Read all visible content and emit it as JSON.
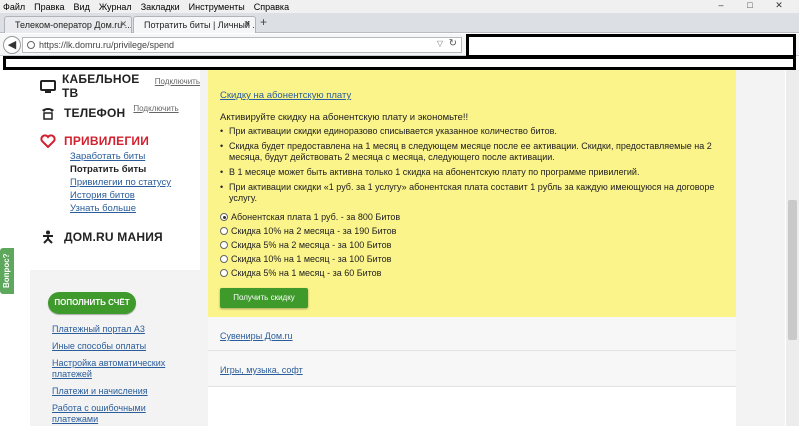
{
  "menu": [
    "Файл",
    "Правка",
    "Вид",
    "Журнал",
    "Закладки",
    "Инструменты",
    "Справка"
  ],
  "window_controls": [
    "–",
    "□",
    "✕"
  ],
  "tabs": [
    {
      "title": "Телеком-оператор Дом.ru ...",
      "close": "✕"
    },
    {
      "title": "Потратить биты | Личный ...",
      "close": "✕"
    }
  ],
  "new_tab": "+",
  "url": "https://lk.domru.ru/privilege/spend",
  "sidebar": {
    "sections": [
      {
        "title": "Кабельное ТВ",
        "off": "Подключить",
        "icon": "tv-icon"
      },
      {
        "title": "Телефон",
        "off": "Подключить",
        "icon": "phone-icon"
      },
      {
        "title": "Привилегии",
        "icon": "heart-icon"
      },
      {
        "title": "Дом.ru мания",
        "icon": "figure-icon"
      }
    ],
    "privilege_items": [
      "Заработать биты",
      "Потратить биты",
      "Привилегии по статусу",
      "История битов",
      "Узнать больше"
    ],
    "topup": "ПОПОЛНИТЬ СЧЁТ",
    "links": [
      "Платежный портал А3",
      "Иные способы оплаты",
      "Настройка автоматических платежей",
      "Платежи и начисления",
      "Работа с ошибочными платежами"
    ]
  },
  "vopros": "Вопрос?",
  "main": {
    "heading": "Скидку на абонентскую плату",
    "intro": "Активируйте скидку на абонентскую плату и экономьте!!",
    "bullets": [
      "При активации скидки единоразово списывается указанное количество битов.",
      "Скидка будет предоставлена на 1 месяц в следующем месяце после ее активации. Скидки, предоставляемые на 2 месяца, будут действовать 2 месяца с месяца, следующего после активации.",
      "В 1 месяце может быть активна только 1 скидка на абонентскую плату по программе привилегий.",
      "При активации скидки «1 руб. за 1 услугу» абонентская плата составит 1 рубль за каждую имеющуюся на договоре услугу."
    ],
    "options": [
      "Абонентская плата 1 руб. - за 800 Битов",
      "Скидка 10% на 2 месяца - за 190 Битов",
      "Скидка 5% на 2 месяца - за 100 Битов",
      "Скидка 10% на 1 месяц - за 100 Битов",
      "Скидка 5% на 1 месяц - за 60 Битов"
    ],
    "get_button": "Получить скидку",
    "sections": [
      "Сувениры Дом.ru",
      "Игры, музыка, софт"
    ]
  },
  "colors": {
    "accent_green": "#3d9a2b",
    "highlight_yellow": "#fbf48b",
    "brand_red": "#d3202e",
    "link_blue": "#2a5d9b"
  }
}
